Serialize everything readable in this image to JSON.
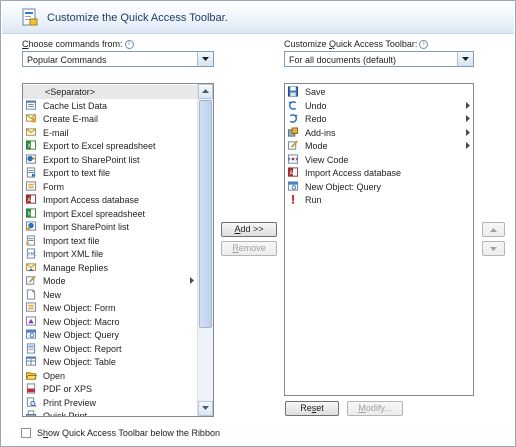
{
  "dialog": {
    "title": "Customize the Quick Access Toolbar."
  },
  "left": {
    "label_prefix": "",
    "label_ul": "C",
    "label_rest": "hoose commands from:",
    "combo_value": "Popular Commands",
    "items": [
      {
        "label": "<Separator>",
        "icon": "separator",
        "sep": true
      },
      {
        "label": "Cache List Data",
        "icon": "cache-list-data-icon"
      },
      {
        "label": "Create E-mail",
        "icon": "create-email-icon"
      },
      {
        "label": "E-mail",
        "icon": "email-icon"
      },
      {
        "label": "Export to Excel spreadsheet",
        "icon": "excel-export-icon"
      },
      {
        "label": "Export to SharePoint list",
        "icon": "sharepoint-export-icon"
      },
      {
        "label": "Export to text file",
        "icon": "text-export-icon"
      },
      {
        "label": "Form",
        "icon": "form-icon"
      },
      {
        "label": "Import Access database",
        "icon": "access-import-icon"
      },
      {
        "label": "Import Excel spreadsheet",
        "icon": "excel-import-icon"
      },
      {
        "label": "Import SharePoint list",
        "icon": "sharepoint-import-icon"
      },
      {
        "label": "Import text file",
        "icon": "text-import-icon"
      },
      {
        "label": "Import XML file",
        "icon": "xml-import-icon"
      },
      {
        "label": "Manage Replies",
        "icon": "manage-replies-icon"
      },
      {
        "label": "Mode",
        "icon": "mode-icon",
        "submenu": true
      },
      {
        "label": "New",
        "icon": "new-icon"
      },
      {
        "label": "New Object: Form",
        "icon": "new-form-icon"
      },
      {
        "label": "New Object: Macro",
        "icon": "new-macro-icon"
      },
      {
        "label": "New Object: Query",
        "icon": "new-query-icon"
      },
      {
        "label": "New Object: Report",
        "icon": "new-report-icon"
      },
      {
        "label": "New Object: Table",
        "icon": "new-table-icon"
      },
      {
        "label": "Open",
        "icon": "open-icon"
      },
      {
        "label": "PDF or XPS",
        "icon": "pdf-icon"
      },
      {
        "label": "Print Preview",
        "icon": "print-preview-icon"
      },
      {
        "label": "Quick Print",
        "icon": "quick-print-icon"
      }
    ]
  },
  "right": {
    "label_prefix": "Customize ",
    "label_ul": "Q",
    "label_rest": "uick Access Toolbar:",
    "combo_value": "For all documents (default)",
    "items": [
      {
        "label": "Save",
        "icon": "save-icon"
      },
      {
        "label": "Undo",
        "icon": "undo-icon",
        "submenu": true
      },
      {
        "label": "Redo",
        "icon": "redo-icon",
        "submenu": true
      },
      {
        "label": "Add-ins",
        "icon": "add-ins-icon",
        "submenu": true
      },
      {
        "label": "Mode",
        "icon": "mode-icon",
        "submenu": true
      },
      {
        "label": "View Code",
        "icon": "view-code-icon"
      },
      {
        "label": "Import Access database",
        "icon": "access-import-icon"
      },
      {
        "label": "New Object: Query",
        "icon": "new-query-icon"
      },
      {
        "label": "Run",
        "icon": "run-icon"
      }
    ]
  },
  "buttons": {
    "add_ul": "A",
    "add_rest": "dd >>",
    "remove_ul": "R",
    "remove_rest": "emove",
    "reset_prefix": "Re",
    "reset_ul": "s",
    "reset_rest": "et",
    "modify_ul": "M",
    "modify_rest": "odify..."
  },
  "footer": {
    "checkbox_ul": "h",
    "checkbox_prefix": "S",
    "checkbox_rest": "ow Quick Access Toolbar below the Ribbon",
    "checked": false
  }
}
